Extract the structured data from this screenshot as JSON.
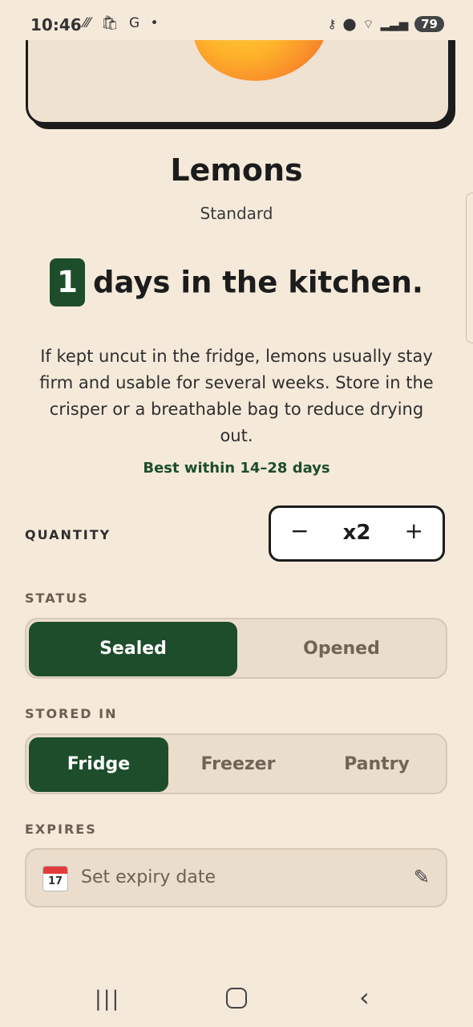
{
  "status_bar": {
    "time": "10:46",
    "left_icons": [
      "slash-icon",
      "bag-icon",
      "G",
      "•"
    ],
    "battery": "79"
  },
  "product": {
    "name": "Lemons",
    "variant": "Standard",
    "days_count": "1",
    "days_text": "days in the kitchen.",
    "description": "If kept uncut in the fridge, lemons usually stay firm and usable for several weeks. Store in the crisper or a breathable bag to reduce drying out.",
    "best_within": "Best within 14–28 days"
  },
  "quantity": {
    "label": "QUANTITY",
    "minus": "−",
    "value": "x2",
    "plus": "+"
  },
  "status": {
    "label": "STATUS",
    "options": [
      "Sealed",
      "Opened"
    ],
    "selected": "Sealed"
  },
  "stored_in": {
    "label": "STORED IN",
    "options": [
      "Fridge",
      "Freezer",
      "Pantry"
    ],
    "selected": "Fridge"
  },
  "expires": {
    "label": "EXPIRES",
    "calendar_day": "17",
    "placeholder": "Set expiry date"
  },
  "colors": {
    "accent": "#1e4d2b",
    "background": "#f5eada"
  }
}
